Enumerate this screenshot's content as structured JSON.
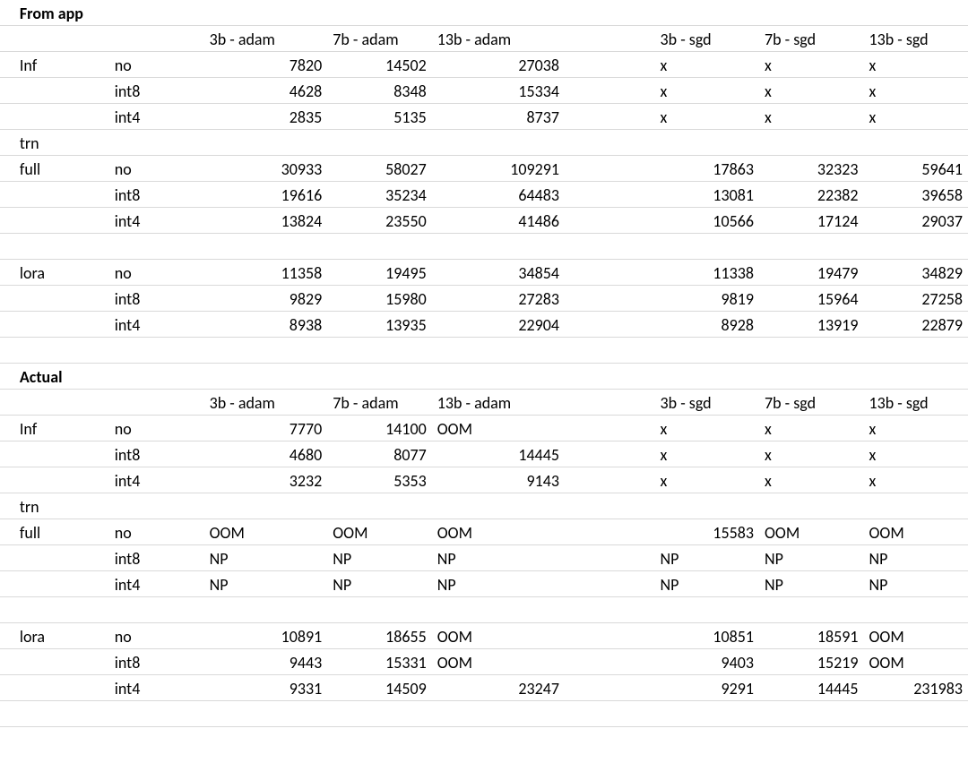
{
  "sections": {
    "from_app_title": "From app",
    "actual_title": "Actual"
  },
  "headers": {
    "adam3b": "3b - adam",
    "adam7b": "7b - adam",
    "adam13b": "13b - adam",
    "sgd3b": "3b - sgd",
    "sgd7b": "7b - sgd",
    "sgd13b": "13b - sgd"
  },
  "labels": {
    "inf": "Inf",
    "trn": "trn",
    "full": "full",
    "lora": "lora",
    "no": "no",
    "int8": "int8",
    "int4": "int4"
  },
  "from_app": {
    "inf": {
      "no": {
        "a3b": "7820",
        "a7b": "14502",
        "a13b": "27038",
        "s3b": "x",
        "s7b": "x",
        "s13b": "x"
      },
      "int8": {
        "a3b": "4628",
        "a7b": "8348",
        "a13b": "15334",
        "s3b": "x",
        "s7b": "x",
        "s13b": "x"
      },
      "int4": {
        "a3b": "2835",
        "a7b": "5135",
        "a13b": "8737",
        "s3b": "x",
        "s7b": "x",
        "s13b": "x"
      }
    },
    "full": {
      "no": {
        "a3b": "30933",
        "a7b": "58027",
        "a13b": "109291",
        "s3b": "17863",
        "s7b": "32323",
        "s13b": "59641"
      },
      "int8": {
        "a3b": "19616",
        "a7b": "35234",
        "a13b": "64483",
        "s3b": "13081",
        "s7b": "22382",
        "s13b": "39658"
      },
      "int4": {
        "a3b": "13824",
        "a7b": "23550",
        "a13b": "41486",
        "s3b": "10566",
        "s7b": "17124",
        "s13b": "29037"
      }
    },
    "lora": {
      "no": {
        "a3b": "11358",
        "a7b": "19495",
        "a13b": "34854",
        "s3b": "11338",
        "s7b": "19479",
        "s13b": "34829"
      },
      "int8": {
        "a3b": "9829",
        "a7b": "15980",
        "a13b": "27283",
        "s3b": "9819",
        "s7b": "15964",
        "s13b": "27258"
      },
      "int4": {
        "a3b": "8938",
        "a7b": "13935",
        "a13b": "22904",
        "s3b": "8928",
        "s7b": "13919",
        "s13b": "22879"
      }
    }
  },
  "actual": {
    "inf": {
      "no": {
        "a3b": "7770",
        "a7b": "14100",
        "a13b": "OOM",
        "s3b": "x",
        "s7b": "x",
        "s13b": "x"
      },
      "int8": {
        "a3b": "4680",
        "a7b": "8077",
        "a13b": "14445",
        "s3b": "x",
        "s7b": "x",
        "s13b": "x"
      },
      "int4": {
        "a3b": "3232",
        "a7b": "5353",
        "a13b": "9143",
        "s3b": "x",
        "s7b": "x",
        "s13b": "x"
      }
    },
    "full": {
      "no": {
        "a3b": "OOM",
        "a7b": "OOM",
        "a13b": "OOM",
        "s3b": "15583",
        "s7b": "OOM",
        "s13b": "OOM"
      },
      "int8": {
        "a3b": "NP",
        "a7b": "NP",
        "a13b": "NP",
        "s3b": "NP",
        "s7b": "NP",
        "s13b": "NP"
      },
      "int4": {
        "a3b": "NP",
        "a7b": "NP",
        "a13b": "NP",
        "s3b": "NP",
        "s7b": "NP",
        "s13b": "NP"
      }
    },
    "lora": {
      "no": {
        "a3b": "10891",
        "a7b": "18655",
        "a13b": "OOM",
        "s3b": "10851",
        "s7b": "18591",
        "s13b": "OOM"
      },
      "int8": {
        "a3b": "9443",
        "a7b": "15331",
        "a13b": "OOM",
        "s3b": "9403",
        "s7b": "15219",
        "s13b": "OOM"
      },
      "int4": {
        "a3b": "9331",
        "a7b": "14509",
        "a13b": "23247",
        "s3b": "9291",
        "s7b": "14445",
        "s13b": "231983"
      }
    }
  }
}
